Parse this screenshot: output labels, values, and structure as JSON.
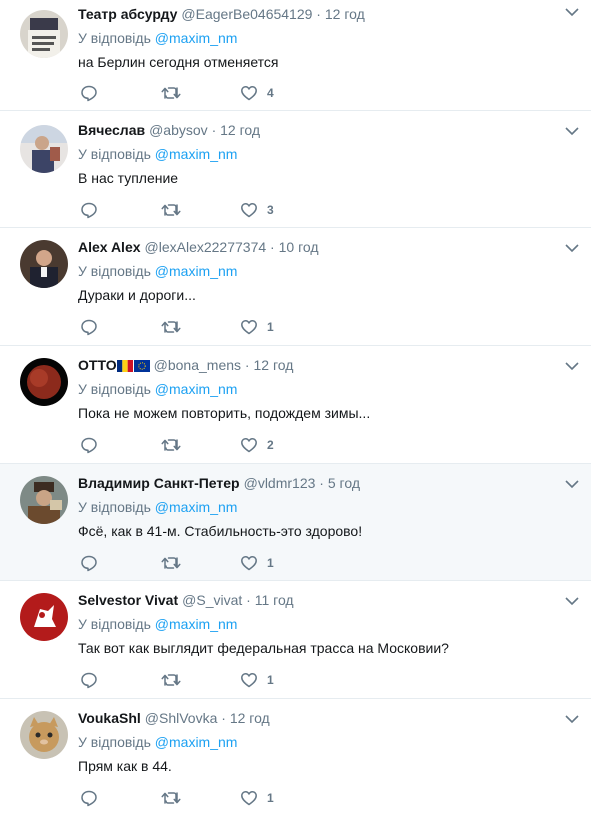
{
  "reply_prefix": "У відповідь",
  "tweets": [
    {
      "name": "Театр абсурду",
      "handle": "@EagerBe04654129",
      "sep": "·",
      "time": "12 год",
      "mention": "@maxim_nm",
      "text": "на Берлин сегодня отменяется",
      "likes": "4"
    },
    {
      "name": "Вячеслав",
      "handle": "@abysov",
      "sep": "·",
      "time": "12 год",
      "mention": "@maxim_nm",
      "text": "В нас тупление",
      "likes": "3"
    },
    {
      "name": "Alex Alex",
      "handle": "@lexAlex22277374",
      "sep": "·",
      "time": "10 год",
      "mention": "@maxim_nm",
      "text": "Дураки и дороги...",
      "likes": "1"
    },
    {
      "name": "OTTO",
      "handle": "@bona_mens",
      "sep": "·",
      "time": "12 год",
      "mention": "@maxim_nm",
      "text": "Пока не можем повторить, подождем зимы...",
      "likes": "2"
    },
    {
      "name": "Владимир Санкт-Петер",
      "handle": "@vldmr123",
      "sep": "·",
      "time": "5 год",
      "mention": "@maxim_nm",
      "text": "Фсё, как в 41-м. Стабильность-это здорово!",
      "likes": "1"
    },
    {
      "name": "Selvestor Vivat",
      "handle": "@S_vivat",
      "sep": "·",
      "time": "11 год",
      "mention": "@maxim_nm",
      "text": "Так вот как выглядит федеральная трасса на Московии?",
      "likes": "1"
    },
    {
      "name": "VoukaShl",
      "handle": "@ShlVovka",
      "sep": "·",
      "time": "12 год",
      "mention": "@maxim_nm",
      "text": "Прям как в 44.",
      "likes": "1"
    }
  ],
  "icons": {
    "reply": "reply-icon",
    "retweet": "retweet-icon",
    "like": "heart-icon",
    "more": "chevron-down-icon"
  },
  "colors": {
    "name": "#14171a",
    "meta": "#657786",
    "mention": "#1da1f2",
    "divider": "#e6ecf0",
    "highlight": "#f5f8fa"
  }
}
